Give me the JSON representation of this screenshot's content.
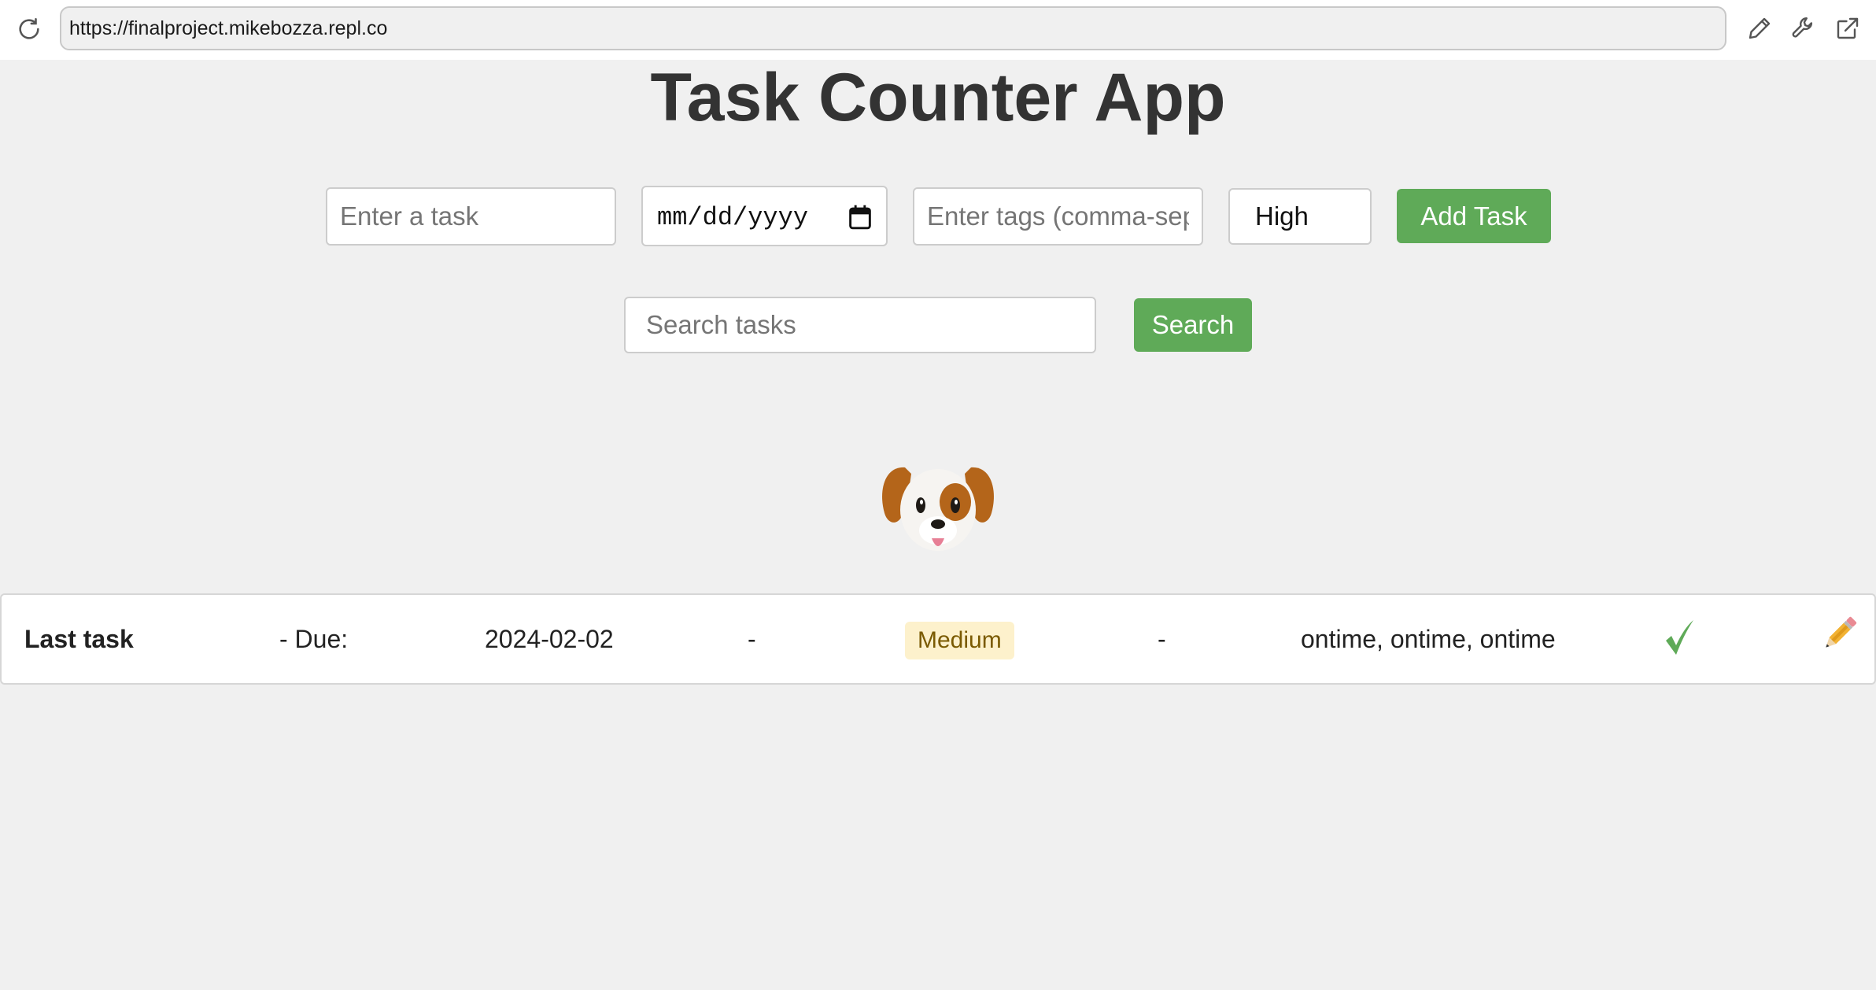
{
  "browser": {
    "url": "https://finalproject.mikebozza.repl.co",
    "icons": [
      "reload-icon",
      "pencil-icon",
      "wrench-icon",
      "open-external-icon"
    ]
  },
  "page": {
    "title": "Task Counter App"
  },
  "task_form": {
    "task_placeholder": "Enter a task",
    "date_placeholder": "mm/dd/yyyy",
    "tags_placeholder": "Enter tags (comma-separated)",
    "priority_selected": "High",
    "add_button": "Add Task"
  },
  "search": {
    "placeholder": "Search tasks",
    "button": "Search"
  },
  "mascot": {
    "icon": "dog-face-icon"
  },
  "tasks": [
    {
      "name": "Last task",
      "due_label": "- Due:",
      "due_date": "2024-02-02",
      "sep1": "-",
      "priority": "Medium",
      "sep2": "-",
      "tags": "ontime, ontime, ontime",
      "complete_icon": "checkmark-icon",
      "edit_icon": "pencil-emoji-icon"
    }
  ],
  "colors": {
    "accent_green": "#5faa58",
    "background": "#f0f0f0",
    "title_text": "#333333",
    "priority_medium_bg": "#fdf1cc"
  }
}
